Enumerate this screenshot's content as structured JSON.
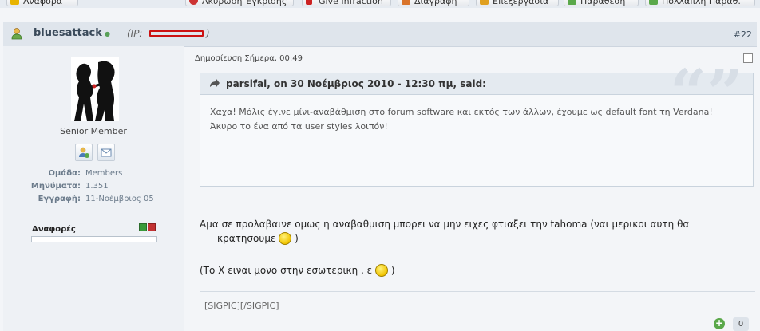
{
  "toolbar": {
    "buttons": [
      {
        "label": "Αναφορά",
        "color": "#e8b400"
      },
      {
        "label": "Ακύρωση Έγκρισης",
        "color": "#cc3333"
      },
      {
        "label": "Give Infraction",
        "color": "#cc2222"
      },
      {
        "label": "Διαγραφή",
        "color": "#d9742b"
      },
      {
        "label": "Επεξεργασία",
        "color": "#e0a020"
      },
      {
        "label": "Παράθεση",
        "color": "#5aa84a"
      },
      {
        "label": "Πολλαπλή Παράθ.",
        "color": "#5aa84a"
      }
    ]
  },
  "post": {
    "username": "bluesattack",
    "ip_prefix": "(IP:",
    "ip_suffix": ")",
    "number": "#22",
    "date": "Δημοσίευση Σήμερα, 00:49"
  },
  "user": {
    "rank": "Senior Member",
    "stats": [
      {
        "label": "Ομάδα:",
        "value": "Members"
      },
      {
        "label": "Μηνύματα:",
        "value": "1.351"
      },
      {
        "label": "Εγγραφή:",
        "value": "11-Νοέμβριος 05"
      }
    ],
    "reputation_label": "Αναφορές"
  },
  "quote": {
    "author": "parsifal, on 30 Νοέμβριος 2010 - 12:30 πμ, said:",
    "line1": "Χαχα! Μόλις έγινε μίνι-αναβάθμιση στο forum software και εκτός των άλλων, έχουμε ως default font τη Verdana!",
    "line2": "Άκυρο το ένα από τα user styles λοιπόν!"
  },
  "body": {
    "p1_part1": "Αμα σε προλαβαινε ομως η αναβαθμιση μπορει να μην ειχες φτιαξει την tahoma (ναι μερικοι αυτη θα",
    "p1_part2": "κρατησουμε",
    "p1_part3": ")",
    "p2_part1": "(Το Χ ειναι μονο στην εσωτερικη , ε",
    "p2_part2": ")"
  },
  "signature": "[SIGPIC][/SIGPIC]",
  "likes": {
    "count": "0"
  }
}
